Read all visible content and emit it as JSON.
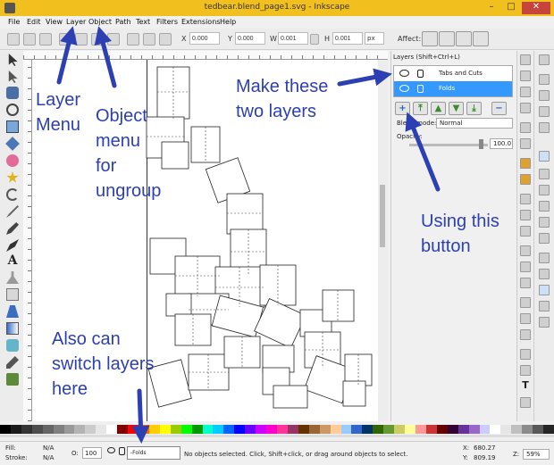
{
  "window": {
    "title": "tedbear.blend_page1.svg - Inkscape",
    "minimize": "–",
    "maximize": "□",
    "close": "✕"
  },
  "menubar": {
    "items": [
      "File",
      "Edit",
      "View",
      "Layer",
      "Object",
      "Path",
      "Text",
      "Filters",
      "Extensions",
      "Help"
    ]
  },
  "toolbar": {
    "x_label": "X",
    "x_value": "0.000",
    "y_label": "Y",
    "y_value": "0.000",
    "w_label": "W",
    "w_value": "0.001",
    "h_label": "H",
    "h_value": "0.001",
    "unit": "px",
    "affect_label": "Affect:"
  },
  "layers_panel": {
    "header": "Layers (Shift+Ctrl+L)",
    "layers": [
      {
        "name": "Tabs and Cuts",
        "selected": false
      },
      {
        "name": "Folds",
        "selected": true
      }
    ],
    "buttons": [
      "+",
      "⤒",
      "▲",
      "▼",
      "⤓",
      "−"
    ],
    "blend_label": "Blend mode:",
    "blend_value": "Normal",
    "opacity_label": "Opacity:",
    "opacity_value": "100.0",
    "opacity_level": 1.0
  },
  "statusbar": {
    "fill_label": "Fill:",
    "fill_value": "N/A",
    "stroke_label": "Stroke:",
    "stroke_value": "N/A",
    "o_label": "O:",
    "o_value": "100",
    "current_layer": "-Folds",
    "message": "No objects selected. Click, Shift+click, or drag around objects to select.",
    "x_label": "X:",
    "x_value": "680.27",
    "y_label": "Y:",
    "y_value": "809.19",
    "zoom_label": "Z:",
    "zoom_value": "59%"
  },
  "annotations": {
    "layer_menu": "Layer\nMenu",
    "object_menu": "Object\nmenu\nfor\nungroup",
    "make_layers": "Make these\ntwo layers",
    "using_button": "Using this\nbutton",
    "switch_layers": "Also can\nswitch layers\nhere"
  },
  "colors": {
    "titlebar": "#f2c01e",
    "annotation": "#2c3fb3",
    "selection": "#3399ff",
    "close_button": "#c7443a"
  }
}
